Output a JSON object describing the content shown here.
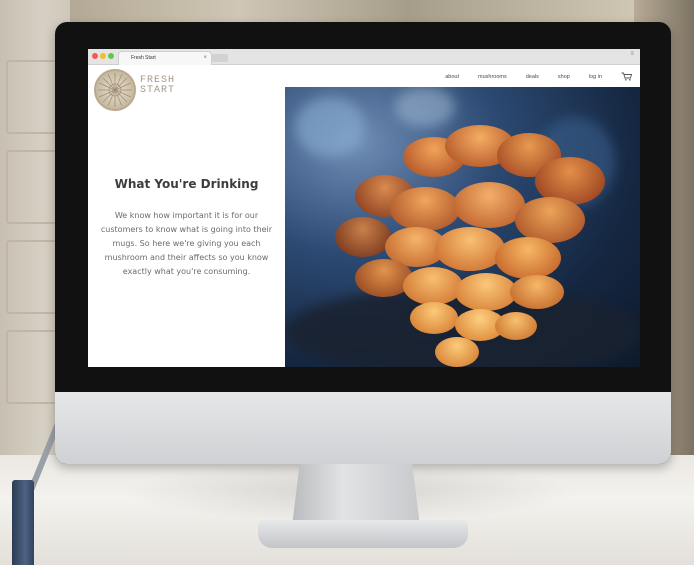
{
  "browser": {
    "tab_title": "Fresh Start",
    "tab_close": "×",
    "menu": "≡"
  },
  "brand": {
    "line1": "FRESH",
    "line2": "START"
  },
  "nav": {
    "items": [
      "about",
      "mushrooms",
      "deals",
      "shop",
      "log in"
    ],
    "cart_icon": "cart-icon"
  },
  "content": {
    "heading": "What You're Drinking",
    "body": "We know how important it is for our customers to know what is going into their mugs. So here we're giving you each mushroom and their affects so you know exactly what you're consuming."
  },
  "colors": {
    "mushroom": "#e89a3c",
    "hero_bg": "#2c4a73",
    "logo": "#a59a86"
  }
}
